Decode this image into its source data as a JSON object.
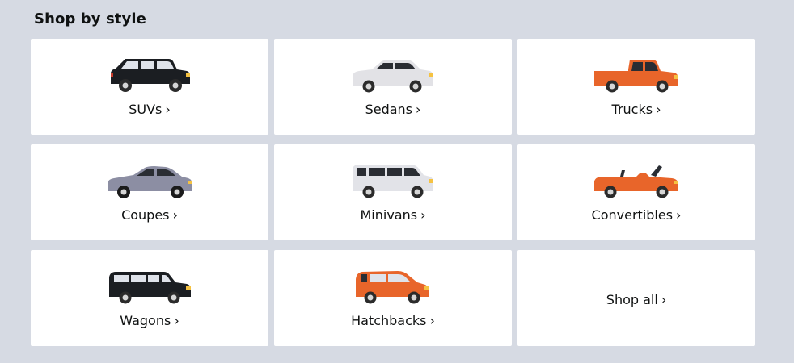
{
  "section": {
    "title": "Shop by style"
  },
  "chevron": "›",
  "cards": [
    {
      "label": "SUVs",
      "icon": "suv-icon",
      "color": "#1b1e22"
    },
    {
      "label": "Sedans",
      "icon": "sedan-icon",
      "color": "#e2e2e6"
    },
    {
      "label": "Trucks",
      "icon": "truck-icon",
      "color": "#e8652a"
    },
    {
      "label": "Coupes",
      "icon": "coupe-icon",
      "color": "#8c8ea3"
    },
    {
      "label": "Minivans",
      "icon": "minivan-icon",
      "color": "#e2e3e8"
    },
    {
      "label": "Convertibles",
      "icon": "convertible-icon",
      "color": "#e8652a"
    },
    {
      "label": "Wagons",
      "icon": "wagon-icon",
      "color": "#1b1e22"
    },
    {
      "label": "Hatchbacks",
      "icon": "hatchback-icon",
      "color": "#e8652a"
    },
    {
      "label": "Shop all"
    }
  ]
}
